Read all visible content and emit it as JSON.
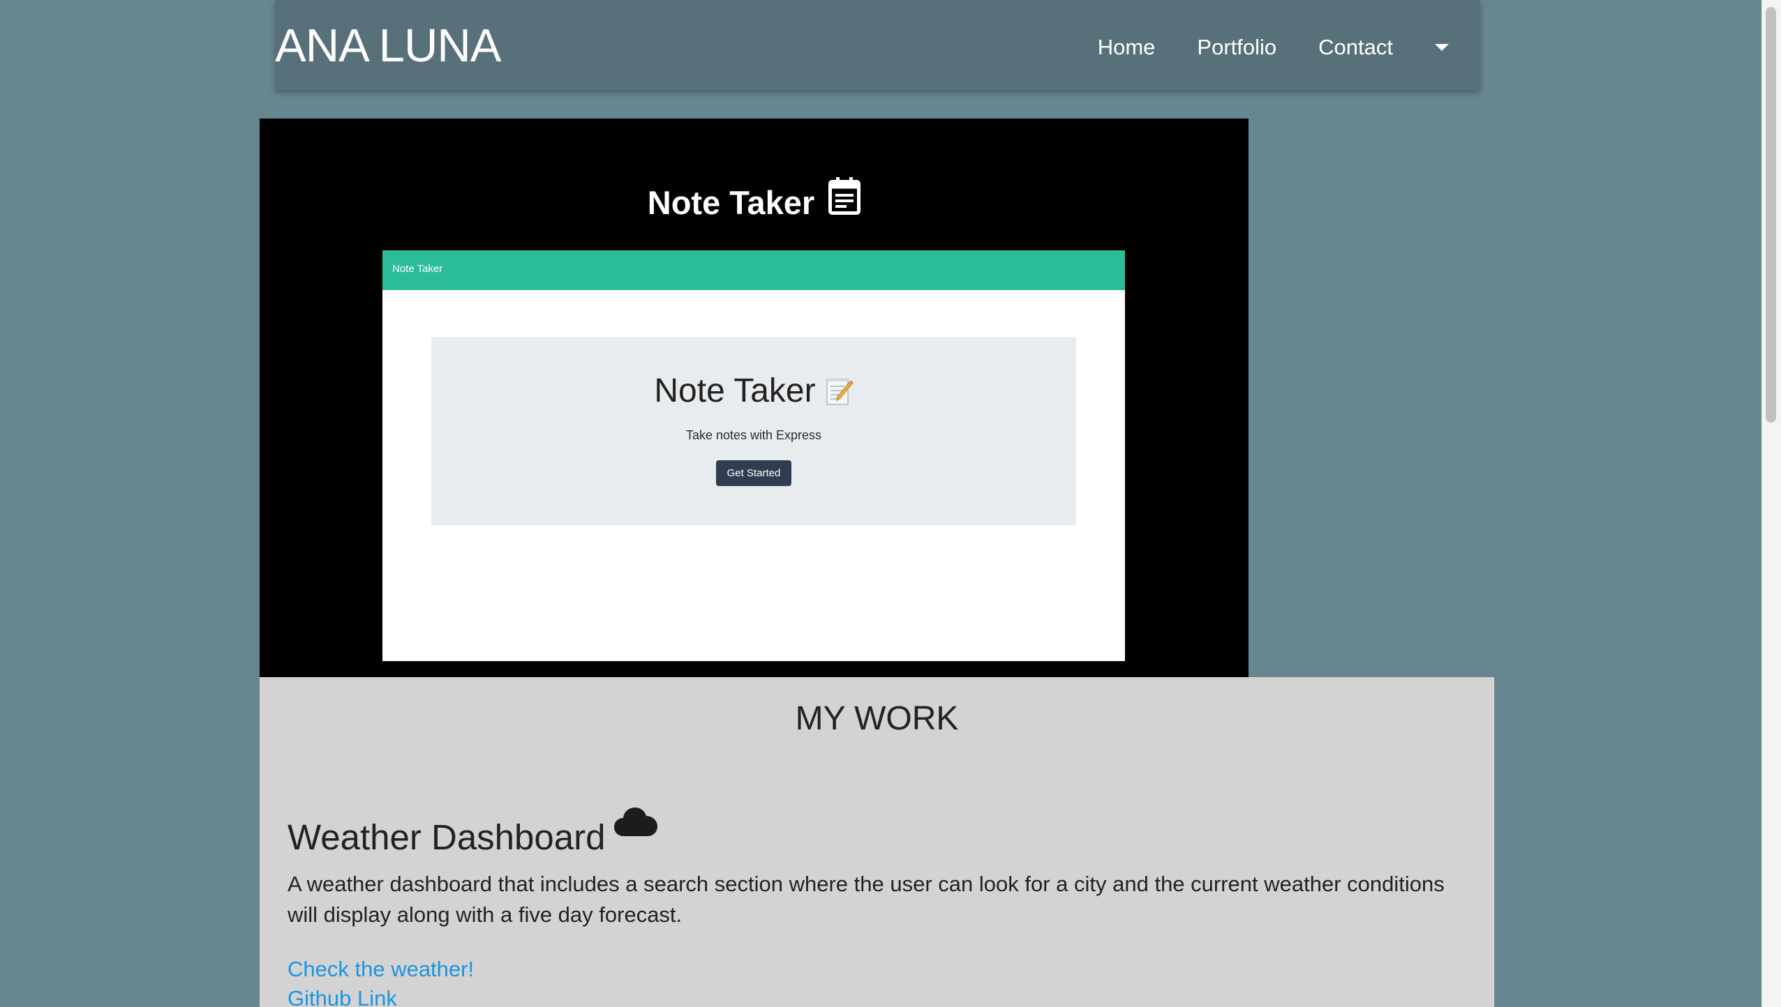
{
  "navbar": {
    "brand": "ANA LUNA",
    "links": [
      "Home",
      "Portfolio",
      "Contact"
    ]
  },
  "hero": {
    "title": "Note Taker",
    "icon": "calendar-note-icon",
    "preview": {
      "bar_title": "Note Taker",
      "jumbo_title": "Note Taker",
      "jumbo_icon": "memo-pencil-icon",
      "subtitle": "Take notes with Express",
      "button_label": "Get Started",
      "accent_color": "#2bbc9c"
    }
  },
  "work": {
    "heading": "MY WORK",
    "project": {
      "title": "Weather Dashboard",
      "icon": "cloud-icon",
      "description": "A weather dashboard that includes a search section where the user can look for a city and the current weather conditions will display along with a five day forecast.",
      "links": [
        "Check the weather!",
        "Github Link"
      ]
    }
  },
  "colors": {
    "background": "#688690",
    "navbar": "#587079",
    "link": "#1a95e0",
    "section": "#d3d3d3"
  }
}
